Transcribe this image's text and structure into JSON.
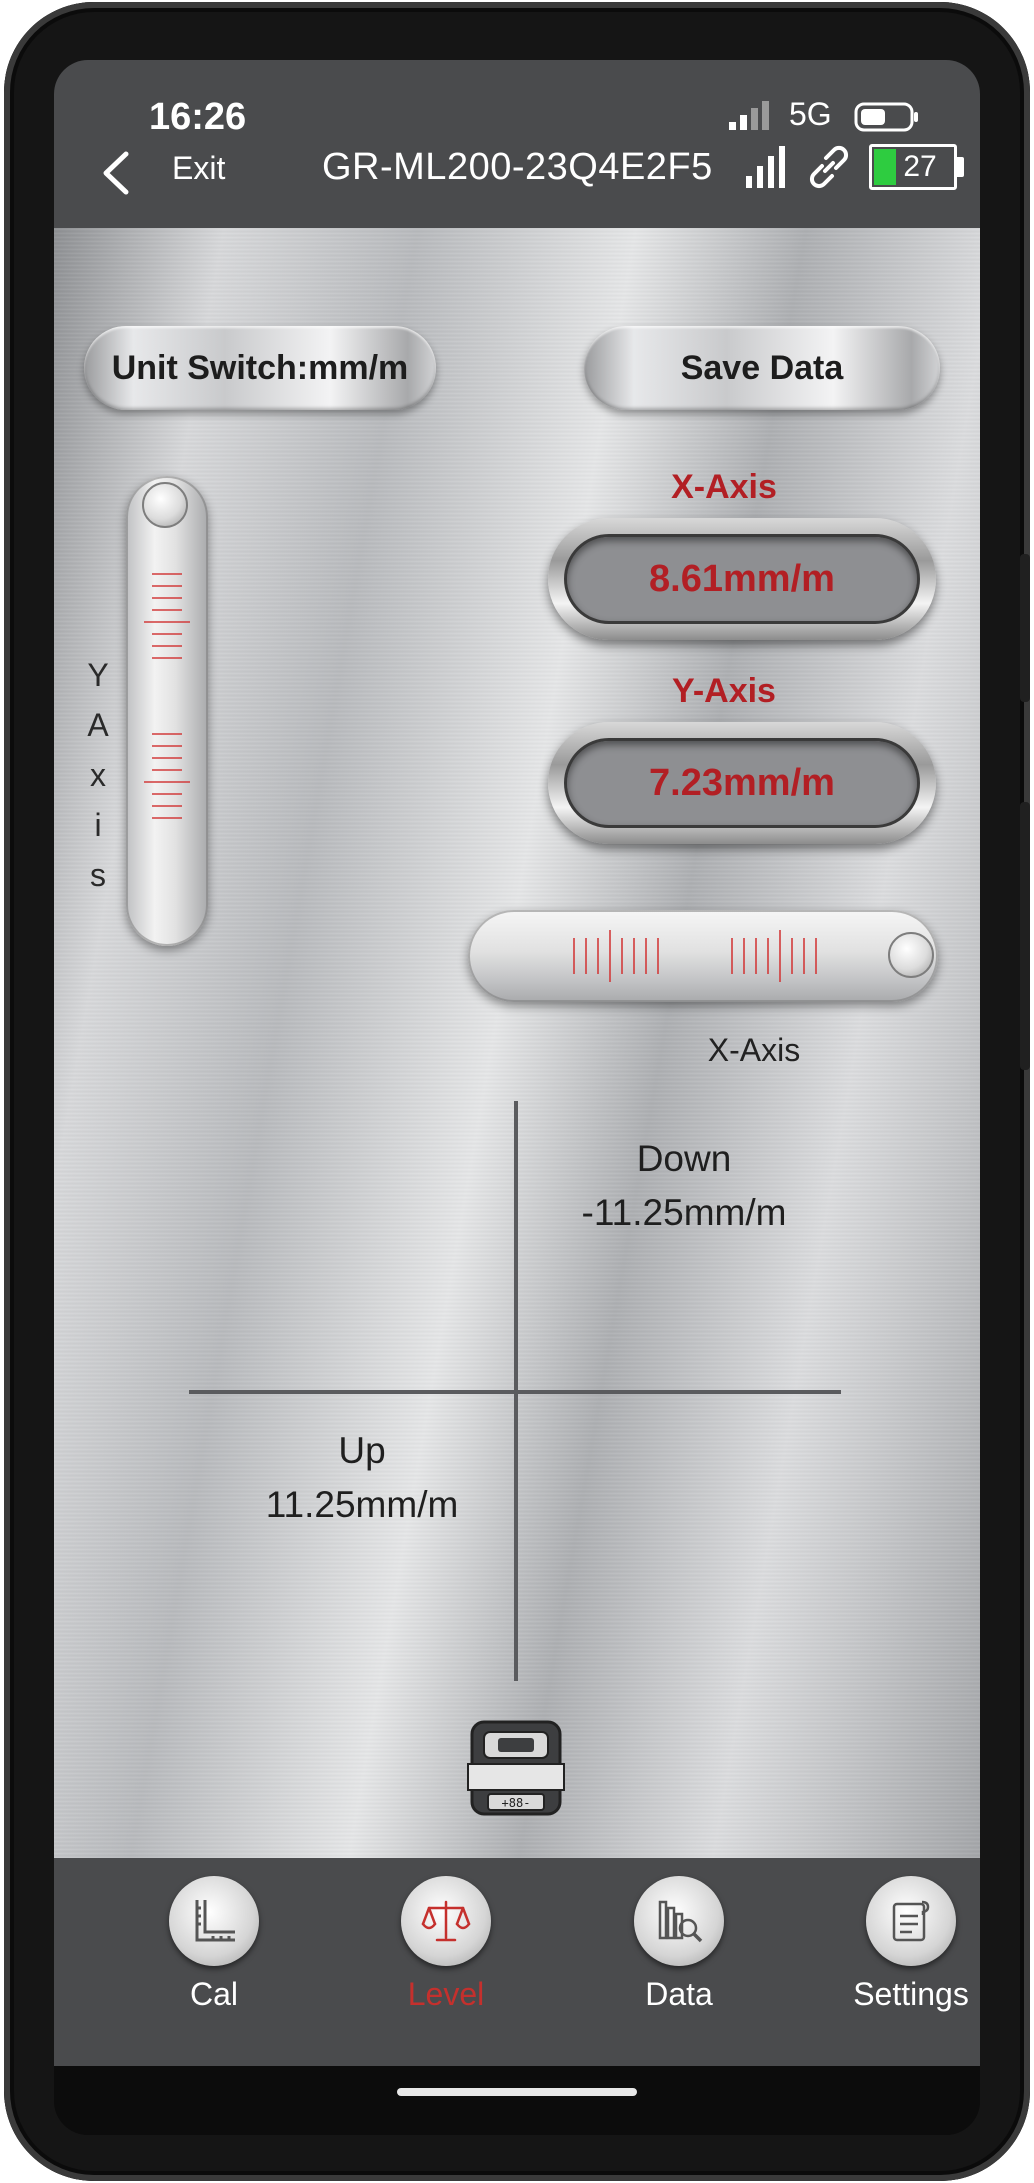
{
  "status": {
    "time": "16:26",
    "network": "5G",
    "battery_level": "27"
  },
  "header": {
    "exit_label": "Exit",
    "device_title": "GR-ML200-23Q4E2F5"
  },
  "controls": {
    "unit_switch_label": "Unit Switch:mm/m",
    "save_label": "Save Data"
  },
  "readouts": {
    "x_caption": "X-Axis",
    "x_value": "8.61mm/m",
    "y_caption": "Y-Axis",
    "y_value": "7.23mm/m"
  },
  "vials": {
    "y_axis_letters": [
      "Y",
      "A",
      "x",
      "i",
      "s"
    ],
    "x_axis_label": "X-Axis"
  },
  "crosshair": {
    "down_label": "Down",
    "down_value": "-11.25mm/m",
    "up_label": "Up",
    "up_value": "11.25mm/m"
  },
  "nav": {
    "active_color": "#c5302d",
    "items": [
      {
        "label": "Cal",
        "icon": "ruler-square-icon"
      },
      {
        "label": "Level",
        "icon": "balance-scale-icon"
      },
      {
        "label": "Data",
        "icon": "data-search-icon"
      },
      {
        "label": "Settings",
        "icon": "settings-note-icon"
      }
    ]
  },
  "colors": {
    "accent_red": "#b21f24",
    "bar_gray": "#4a4b4d"
  }
}
